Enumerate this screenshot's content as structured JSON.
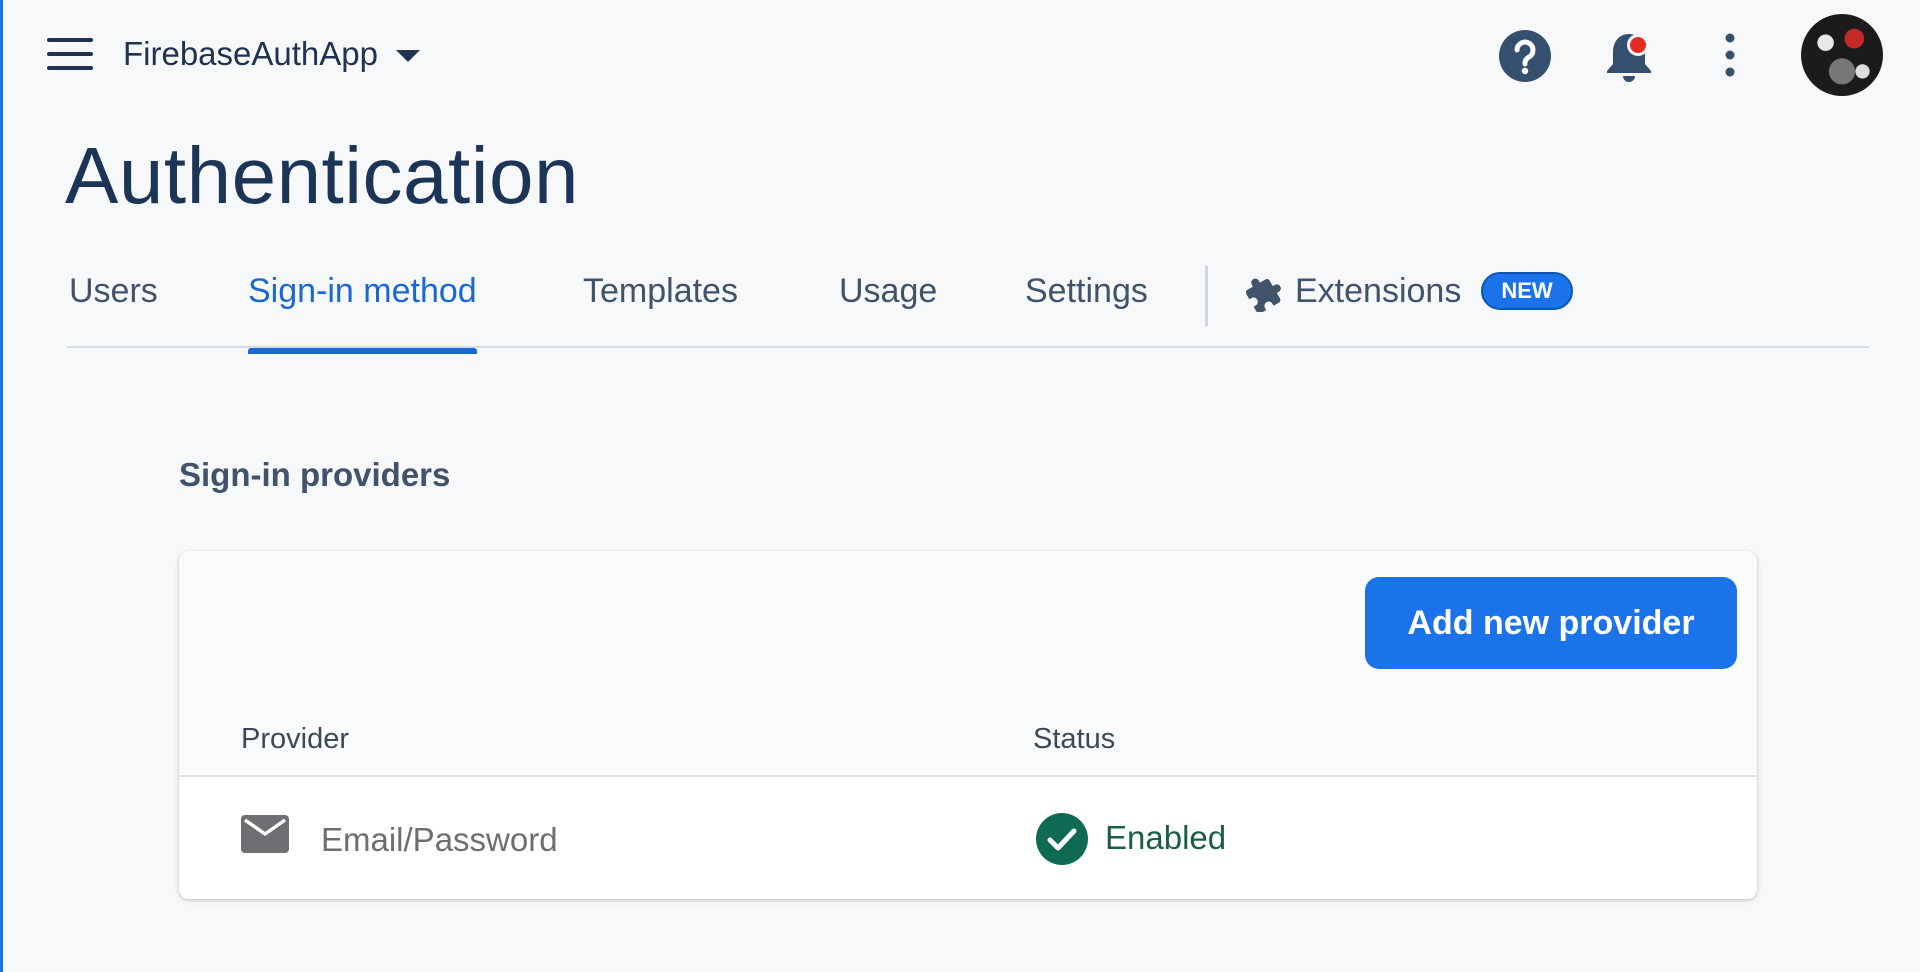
{
  "header": {
    "project_name": "FirebaseAuthApp",
    "icons": [
      "menu-icon",
      "chevron-down-icon",
      "help-icon",
      "notification-bell-icon",
      "more-vert-icon",
      "avatar"
    ]
  },
  "page": {
    "title": "Authentication"
  },
  "tabs": [
    {
      "label": "Users",
      "active": false
    },
    {
      "label": "Sign-in method",
      "active": true
    },
    {
      "label": "Templates",
      "active": false
    },
    {
      "label": "Usage",
      "active": false
    },
    {
      "label": "Settings",
      "active": false
    },
    {
      "label": "Extensions",
      "active": false,
      "badge": "NEW",
      "icon": "extension-icon"
    }
  ],
  "providers": {
    "section_title": "Sign-in providers",
    "add_button_label": "Add new provider",
    "columns": [
      "Provider",
      "Status"
    ],
    "rows": [
      {
        "provider": "Email/Password",
        "provider_icon": "email-icon",
        "status": "Enabled",
        "status_icon": "check-circle-icon"
      }
    ]
  },
  "colors": {
    "accent": "#1a73e8",
    "title": "#1c3556",
    "enabled": "#0f6a54",
    "background": "#f6f8fa"
  }
}
